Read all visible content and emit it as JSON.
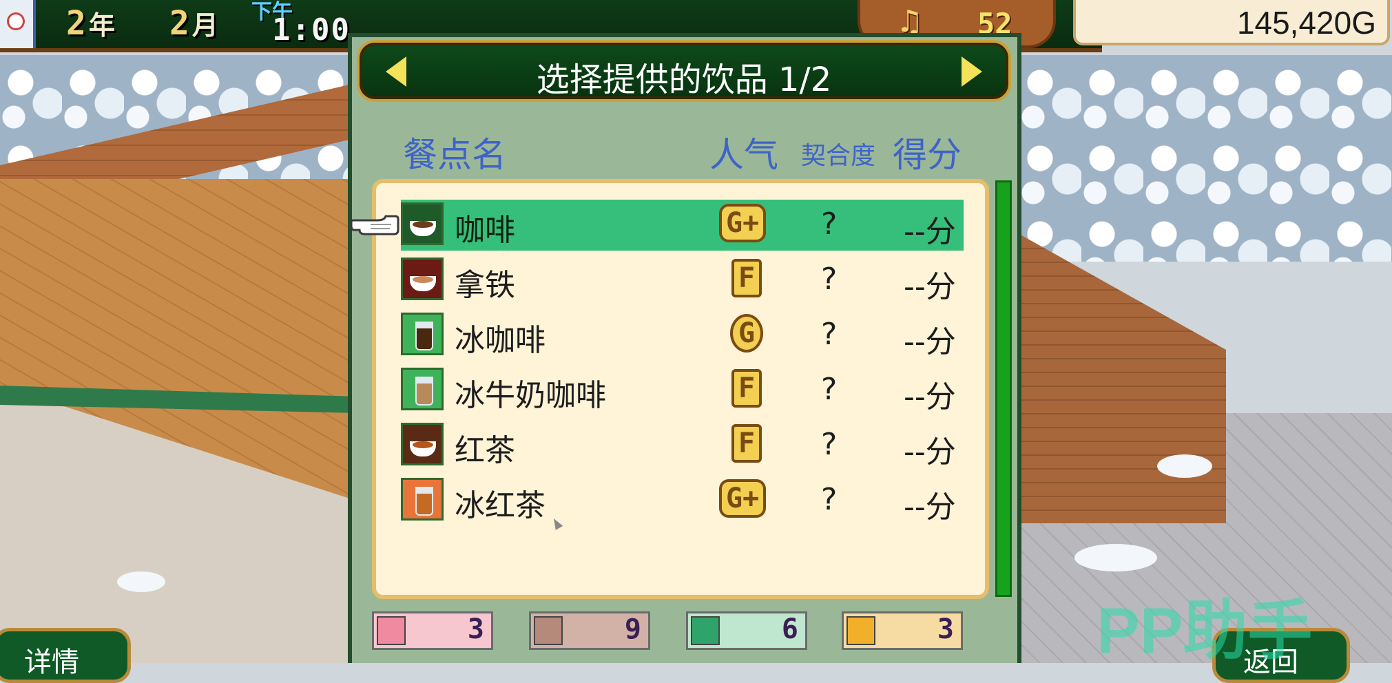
{
  "hud": {
    "year_num": "2",
    "year_unit": "年",
    "month_num": "2",
    "month_unit": "月",
    "ampm": "下午",
    "clock": "1:00",
    "music_count": "52",
    "money": "145,420G"
  },
  "panel": {
    "title": "选择提供的饮品 1/2",
    "headers": {
      "name": "餐点名",
      "popularity": "人气",
      "match": "契合度",
      "score": "得分"
    }
  },
  "items": [
    {
      "name": "咖啡",
      "rank": "G+",
      "match": "?",
      "score": "--分",
      "liquid": "#6b3b1a",
      "bg": "#1f5a2a",
      "iced": false,
      "selected": true
    },
    {
      "name": "拿铁",
      "rank": "F",
      "match": "?",
      "score": "--分",
      "liquid": "#c9895a",
      "bg": "#6b1a14",
      "iced": false,
      "selected": false
    },
    {
      "name": "冰咖啡",
      "rank": "G",
      "match": "?",
      "score": "--分",
      "liquid": "#4a2810",
      "bg": "#3fb35a",
      "iced": true,
      "selected": false
    },
    {
      "name": "冰牛奶咖啡",
      "rank": "F",
      "match": "?",
      "score": "--分",
      "liquid": "#b88a5a",
      "bg": "#3fb35a",
      "iced": true,
      "selected": false
    },
    {
      "name": "红茶",
      "rank": "F",
      "match": "?",
      "score": "--分",
      "liquid": "#b5561c",
      "bg": "#5a2a14",
      "iced": false,
      "selected": false
    },
    {
      "name": "冰红茶",
      "rank": "G+",
      "match": "?",
      "score": "--分",
      "liquid": "#c46a24",
      "bg": "#e8743a",
      "iced": true,
      "selected": false
    }
  ],
  "stats": [
    {
      "icon": "happy-face-icon",
      "value": "3",
      "bg": "#f6c7cf",
      "icon_bg": "#f08aa0"
    },
    {
      "icon": "neutral-face-icon",
      "value": "9",
      "bg": "#d2b2a6",
      "icon_bg": "#b58a7a"
    },
    {
      "icon": "trend-icon",
      "value": "6",
      "bg": "#bfe6cf",
      "icon_bg": "#2fa46a"
    },
    {
      "icon": "sparkle-icon",
      "value": "3",
      "bg": "#f6dca2",
      "icon_bg": "#f2b02a"
    }
  ],
  "buttons": {
    "details": "详情",
    "back": "返回"
  },
  "watermark": "PP助手"
}
